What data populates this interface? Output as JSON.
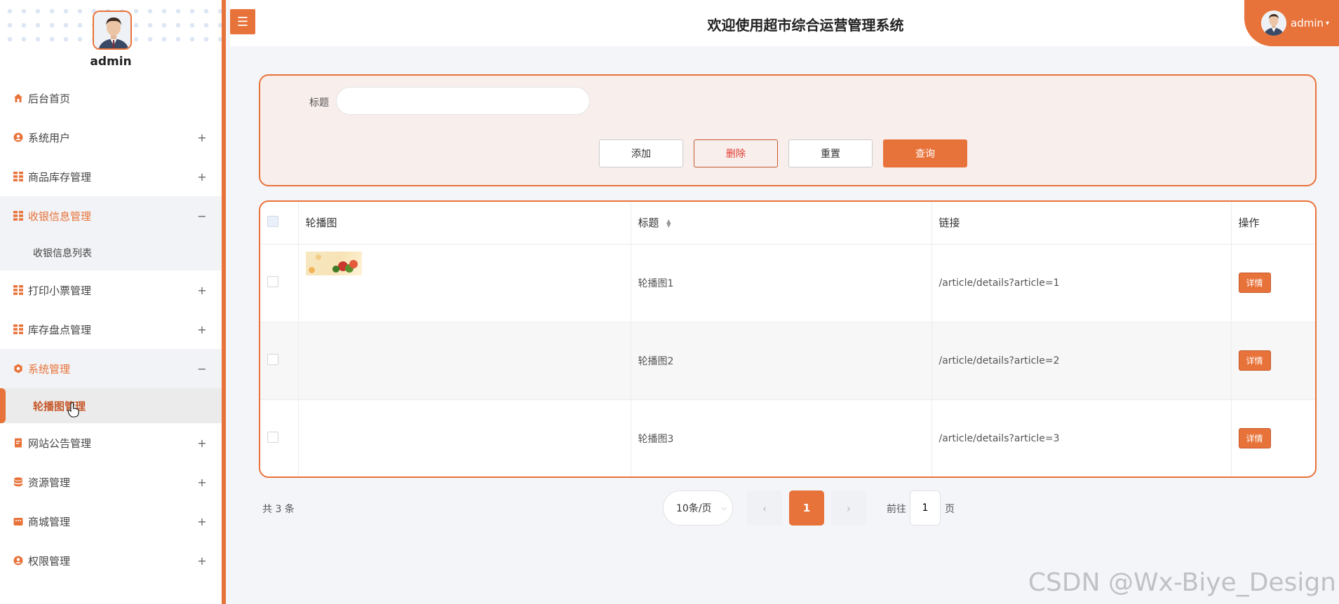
{
  "app": {
    "title": "欢迎使用超市综合运营管理系统",
    "user": "admin",
    "accent": "#e8733a"
  },
  "sidebar": {
    "username": "admin",
    "items": [
      {
        "label": "后台首页",
        "icon": "home-icon",
        "toggle": ""
      },
      {
        "label": "系统用户",
        "icon": "user-icon",
        "toggle": "+"
      },
      {
        "label": "商品库存管理",
        "icon": "grid-icon",
        "toggle": "+"
      },
      {
        "label": "收银信息管理",
        "icon": "grid-icon",
        "toggle": "−"
      },
      {
        "label": "收银信息列表"
      },
      {
        "label": "打印小票管理",
        "icon": "grid-icon",
        "toggle": "+"
      },
      {
        "label": "库存盘点管理",
        "icon": "grid-icon",
        "toggle": "+"
      },
      {
        "label": "系统管理",
        "icon": "gear-icon",
        "toggle": "−"
      },
      {
        "label": "轮播图管理"
      },
      {
        "label": "网站公告管理",
        "icon": "document-icon",
        "toggle": "+"
      },
      {
        "label": "资源管理",
        "icon": "database-icon",
        "toggle": "+"
      },
      {
        "label": "商城管理",
        "icon": "shop-icon",
        "toggle": "+"
      },
      {
        "label": "权限管理",
        "icon": "user-icon",
        "toggle": "+"
      }
    ]
  },
  "search": {
    "title_label": "标题",
    "title_value": "",
    "add_label": "添加",
    "delete_label": "删除",
    "reset_label": "重置",
    "query_label": "查询"
  },
  "table": {
    "columns": [
      "轮播图",
      "标题",
      "链接",
      "操作"
    ],
    "rows": [
      {
        "title": "轮播图1",
        "link": "/article/details?article=1",
        "action": "详情"
      },
      {
        "title": "轮播图2",
        "link": "/article/details?article=2",
        "action": "详情"
      },
      {
        "title": "轮播图3",
        "link": "/article/details?article=3",
        "action": "详情"
      }
    ]
  },
  "pagination": {
    "total_text": "共 3 条",
    "page_size": "10条/页",
    "current_page": "1",
    "goto_prefix": "前往",
    "goto_value": "1",
    "goto_suffix": "页"
  },
  "watermark": "CSDN @Wx-Biye_Design"
}
